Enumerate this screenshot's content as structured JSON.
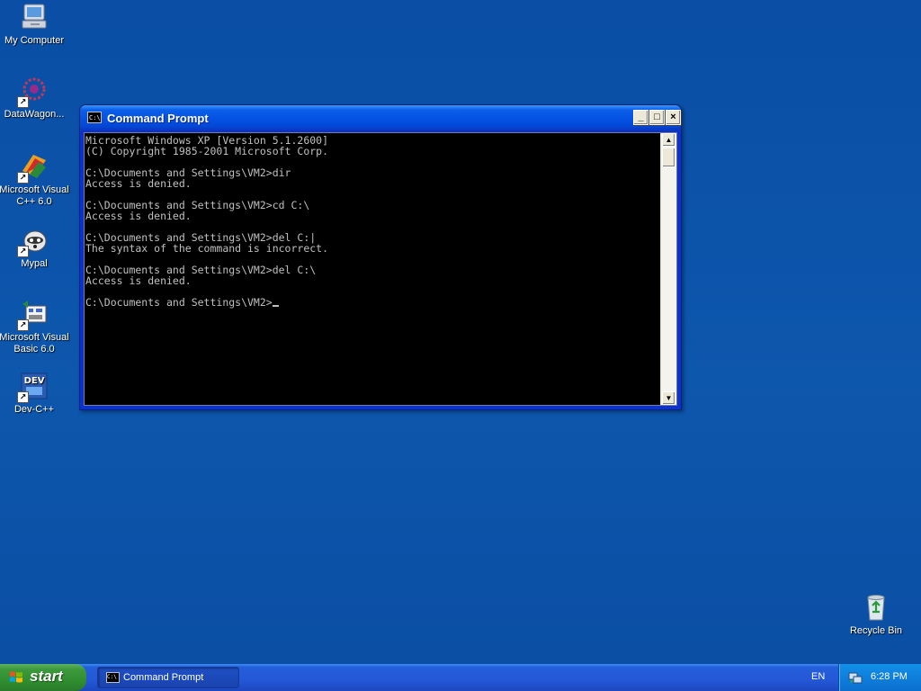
{
  "desktop": {
    "icons": [
      {
        "label": "My Computer",
        "icon": "my-computer-icon"
      },
      {
        "label": "DataWagon...",
        "icon": "datawagon-icon"
      },
      {
        "label": "Microsoft Visual C++ 6.0",
        "icon": "visual-cpp-icon"
      },
      {
        "label": "Mypal",
        "icon": "mypal-icon"
      },
      {
        "label": "Microsoft Visual Basic 6.0",
        "icon": "visual-basic-icon"
      },
      {
        "label": "Dev-C++",
        "icon": "dev-cpp-icon"
      },
      {
        "label": "Recycle Bin",
        "icon": "recycle-bin-icon"
      }
    ],
    "background_color": "#0b4fa3"
  },
  "window": {
    "title": "Command Prompt",
    "icon_text": "C:\\",
    "buttons": {
      "minimize": "_",
      "maximize": "□",
      "close": "×"
    },
    "console_lines": [
      "Microsoft Windows XP [Version 5.1.2600]",
      "(C) Copyright 1985-2001 Microsoft Corp.",
      "",
      "C:\\Documents and Settings\\VM2>dir",
      "Access is denied.",
      "",
      "C:\\Documents and Settings\\VM2>cd C:\\",
      "Access is denied.",
      "",
      "C:\\Documents and Settings\\VM2>del C:|",
      "The syntax of the command is incorrect.",
      "",
      "C:\\Documents and Settings\\VM2>del C:\\",
      "Access is denied.",
      "",
      "C:\\Documents and Settings\\VM2>"
    ],
    "scroll_up": "▲",
    "scroll_down": "▼"
  },
  "taskbar": {
    "start_label": "start",
    "task_items": [
      {
        "label": "Command Prompt",
        "icon_text": "C:\\"
      }
    ],
    "language": "EN",
    "clock": "6:28 PM"
  }
}
